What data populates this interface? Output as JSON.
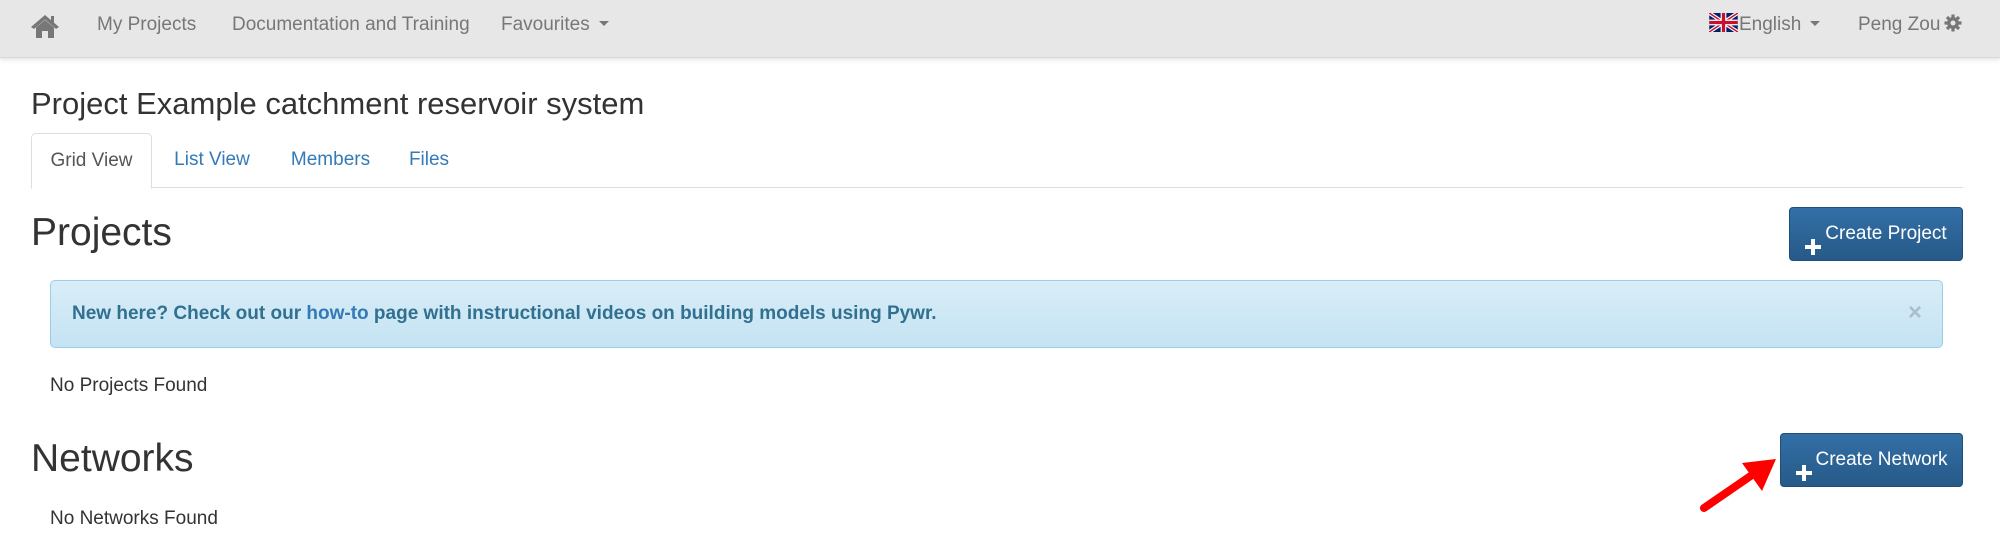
{
  "navbar": {
    "home_icon": "home-icon",
    "links": {
      "my_projects": "My Projects",
      "documentation": "Documentation and Training",
      "favourites": "Favourites"
    },
    "language": {
      "label": "English",
      "flag_icon": "uk-flag-icon"
    },
    "user": {
      "name": "Peng Zou",
      "icon": "gear-icon"
    }
  },
  "page": {
    "title": "Project Example catchment reservoir system"
  },
  "tabs": [
    {
      "label": "Grid View",
      "active": true
    },
    {
      "label": "List View",
      "active": false
    },
    {
      "label": "Members",
      "active": false
    },
    {
      "label": "Files",
      "active": false
    }
  ],
  "projects": {
    "heading": "Projects",
    "create_button": "Create Project",
    "alert": {
      "prefix": "New here? Check out our ",
      "link": "how-to",
      "suffix": " page with instructional videos on building models using Pywr.",
      "close": "×"
    },
    "empty_message": "No Projects Found"
  },
  "networks": {
    "heading": "Networks",
    "create_button": "Create Network",
    "empty_message": "No Networks Found"
  },
  "colors": {
    "navbar_bg": "#e7e7e7",
    "primary_button": "#2a6496",
    "link": "#337ab7",
    "alert_bg": "#d9edf7",
    "annotation_arrow": "#ff0000"
  }
}
